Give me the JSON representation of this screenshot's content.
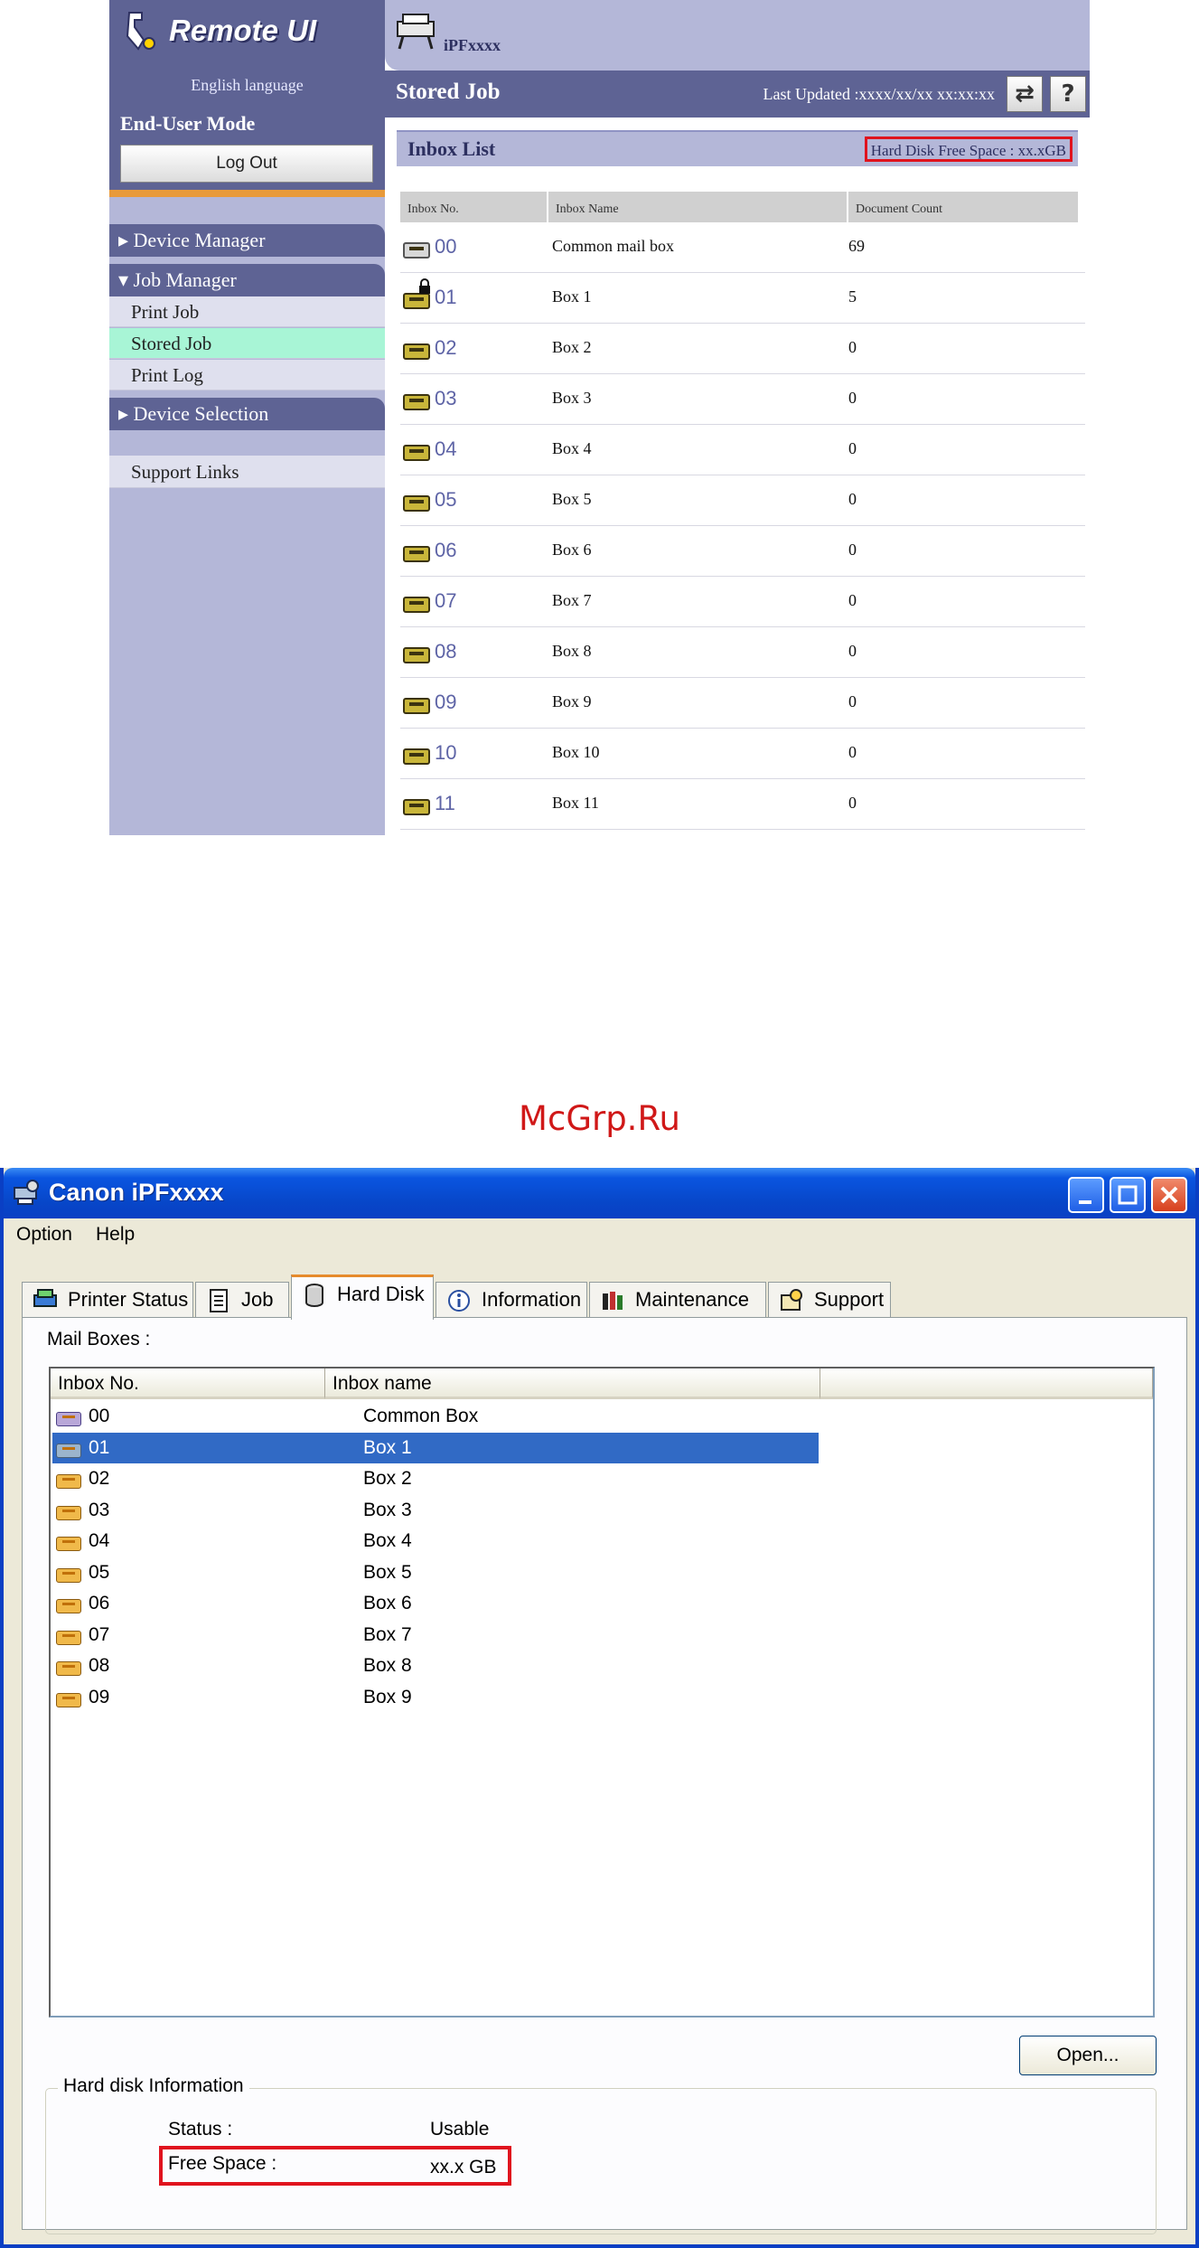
{
  "remote_ui": {
    "logo": "Remote UI",
    "language": "English language",
    "mode": "End-User Mode",
    "logout_label": "Log Out",
    "printer_name": "iPFxxxx",
    "page_title": "Stored Job",
    "last_updated": "Last Updated :xxxx/xx/xx xx:xx:xx",
    "refresh_icon": "refresh-icon",
    "help_label": "?",
    "nav": {
      "device_manager": "Device Manager",
      "job_manager": "Job Manager",
      "print_job": "Print Job",
      "stored_job": "Stored Job",
      "print_log": "Print Log",
      "device_selection": "Device Selection",
      "support_links": "Support Links"
    },
    "inbox_title": "Inbox List",
    "hard_disk_free": "Hard Disk Free Space : xx.xGB",
    "columns": [
      "Inbox No.",
      "Inbox Name",
      "Document Count"
    ],
    "rows": [
      {
        "no": "00",
        "name": "Common mail box",
        "count": "69",
        "icon": "common-mailbox-icon"
      },
      {
        "no": "01",
        "name": "Box 1",
        "count": "5",
        "icon": "locked-mailbox-icon"
      },
      {
        "no": "02",
        "name": "Box 2",
        "count": "0",
        "icon": "mailbox-icon"
      },
      {
        "no": "03",
        "name": "Box 3",
        "count": "0",
        "icon": "mailbox-icon"
      },
      {
        "no": "04",
        "name": "Box 4",
        "count": "0",
        "icon": "mailbox-icon"
      },
      {
        "no": "05",
        "name": "Box 5",
        "count": "0",
        "icon": "mailbox-icon"
      },
      {
        "no": "06",
        "name": "Box 6",
        "count": "0",
        "icon": "mailbox-icon"
      },
      {
        "no": "07",
        "name": "Box 7",
        "count": "0",
        "icon": "mailbox-icon"
      },
      {
        "no": "08",
        "name": "Box 8",
        "count": "0",
        "icon": "mailbox-icon"
      },
      {
        "no": "09",
        "name": "Box 9",
        "count": "0",
        "icon": "mailbox-icon"
      },
      {
        "no": "10",
        "name": "Box 10",
        "count": "0",
        "icon": "mailbox-icon"
      },
      {
        "no": "11",
        "name": "Box 11",
        "count": "0",
        "icon": "mailbox-icon"
      }
    ]
  },
  "watermark": "McGrp.Ru",
  "window": {
    "title": "Canon iPFxxxx",
    "menu": {
      "option": "Option",
      "help": "Help"
    },
    "tabs": [
      {
        "label": "Printer Status",
        "icon": "printer-status-icon"
      },
      {
        "label": "Job",
        "icon": "job-list-icon"
      },
      {
        "label": "Hard Disk",
        "icon": "hard-disk-icon",
        "active": true
      },
      {
        "label": "Information",
        "icon": "info-icon"
      },
      {
        "label": "Maintenance",
        "icon": "maintenance-icon"
      },
      {
        "label": "Support",
        "icon": "support-icon"
      }
    ],
    "mail_boxes_label": "Mail Boxes :",
    "columns": [
      "Inbox No.",
      "Inbox name"
    ],
    "rows": [
      {
        "no": "00",
        "name": "Common Box"
      },
      {
        "no": "01",
        "name": "Box 1",
        "selected": true
      },
      {
        "no": "02",
        "name": "Box 2"
      },
      {
        "no": "03",
        "name": "Box 3"
      },
      {
        "no": "04",
        "name": "Box 4"
      },
      {
        "no": "05",
        "name": "Box 5"
      },
      {
        "no": "06",
        "name": "Box 6"
      },
      {
        "no": "07",
        "name": "Box 7"
      },
      {
        "no": "08",
        "name": "Box 8"
      },
      {
        "no": "09",
        "name": "Box 9"
      }
    ],
    "open_button": "Open...",
    "hard_disk_info": {
      "group_title": "Hard disk Information",
      "status_label": "Status :",
      "status_value": "Usable",
      "free_label": "Free Space :",
      "free_value": "xx.x GB"
    }
  },
  "colors": {
    "accent_red": "#e0131e",
    "remote_ui_navy": "#5e6394",
    "selection_blue": "#316ac5"
  }
}
